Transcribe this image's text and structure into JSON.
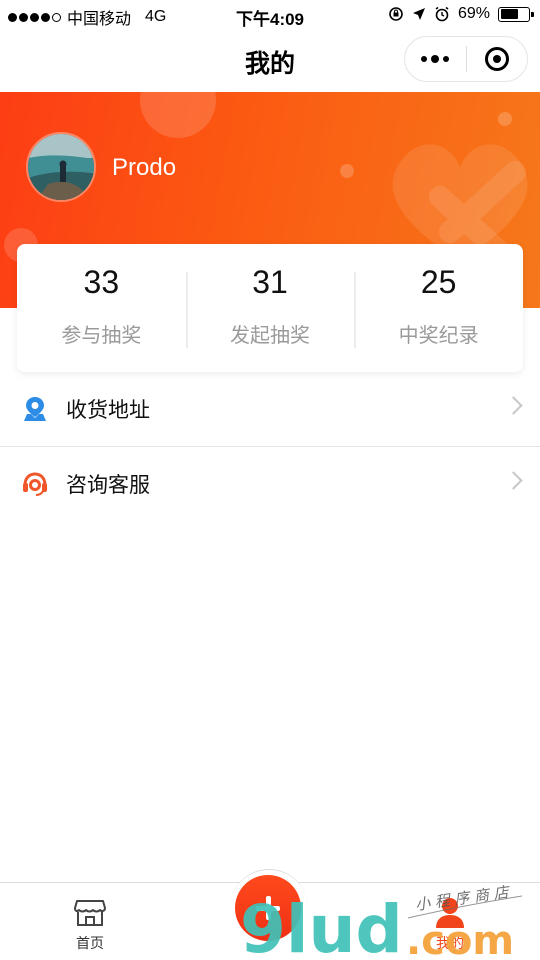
{
  "status_bar": {
    "carrier": "中国移动",
    "network": "4G",
    "time": "下午4:09",
    "battery": "69%",
    "battery_level": 0.69
  },
  "nav": {
    "title": "我的"
  },
  "profile": {
    "username": "Prodo"
  },
  "stats": [
    {
      "value": "33",
      "label": "参与抽奖"
    },
    {
      "value": "31",
      "label": "发起抽奖"
    },
    {
      "value": "25",
      "label": "中奖纪录"
    }
  ],
  "menu": [
    {
      "label": "收货地址",
      "icon": "location-pin-icon"
    },
    {
      "label": "咨询客服",
      "icon": "headset-icon"
    }
  ],
  "tab_bar": {
    "home_label": "首页",
    "mine_label": "我的"
  },
  "watermark": {
    "logo_text": "9lud",
    "domain_text": ".com",
    "slogan": "小程序商店"
  },
  "colors": {
    "accent": "#f2441b",
    "banner_start": "#fd3d14",
    "banner_end": "#f6781a",
    "pin_blue": "#2c8ce6"
  }
}
